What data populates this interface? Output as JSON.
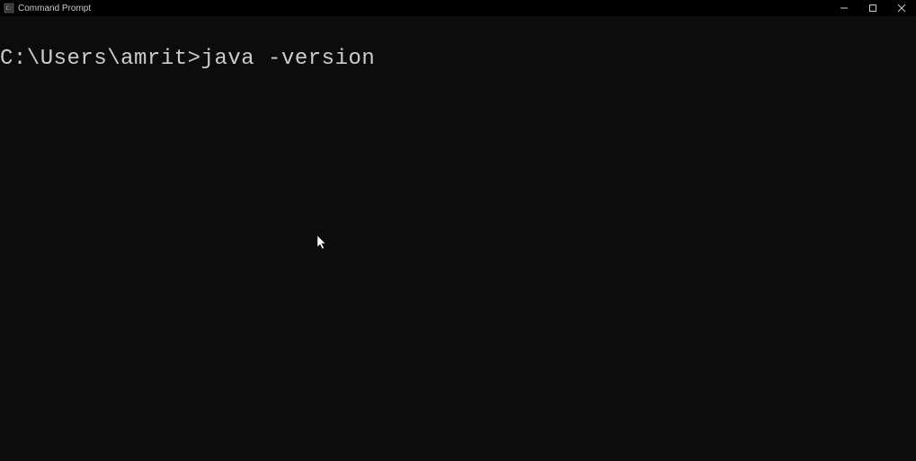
{
  "window": {
    "title": "Command Prompt"
  },
  "terminal": {
    "prompt": "C:\\Users\\amrit>",
    "command": "java -version"
  }
}
